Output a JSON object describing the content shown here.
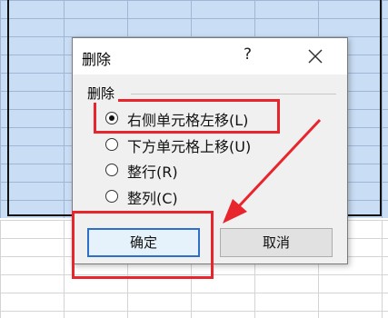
{
  "dialog": {
    "title": "删除",
    "help_label": "?",
    "group_label": "删除",
    "options": [
      {
        "label": "右侧单元格左移(L)",
        "checked": true
      },
      {
        "label": "下方单元格上移(U)",
        "checked": false
      },
      {
        "label": "整行(R)",
        "checked": false
      },
      {
        "label": "整列(C)",
        "checked": false
      }
    ],
    "ok_label": "确定",
    "cancel_label": "取消"
  },
  "colors": {
    "annotation_red": "#e8242c",
    "selection_blue": "#c9ddf5",
    "default_button_border": "#2f6fc9"
  },
  "icons": {
    "close": "close-icon",
    "radio": "radio-button-icon"
  }
}
